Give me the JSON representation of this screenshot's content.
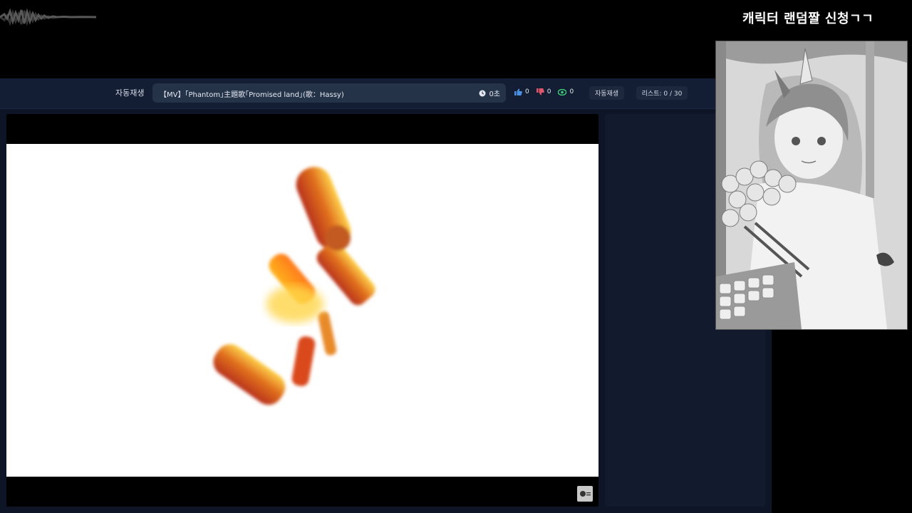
{
  "overlay": {
    "title": "캐릭터 랜덤짤 신청ㄱㄱ"
  },
  "controls": {
    "autoplay_label": "자동재생",
    "now_playing_title": "【MV】｢Phantom｣主題歌｢Promised land｣(歌：Hassy)",
    "time": "0초",
    "likes": "0",
    "dislikes": "0",
    "views": "0",
    "autoplay_button": "자동재생",
    "list_status": "리스트: 0 / 30"
  },
  "colors": {
    "accent_like": "#4a90e2",
    "accent_dislike": "#e2566b",
    "accent_views": "#3ccf7a",
    "panel_bg": "#0d1526"
  },
  "icons": {
    "clock": "clock-icon",
    "like": "thumbs-up-icon",
    "dislike": "thumbs-down-icon",
    "views": "eye-icon"
  }
}
